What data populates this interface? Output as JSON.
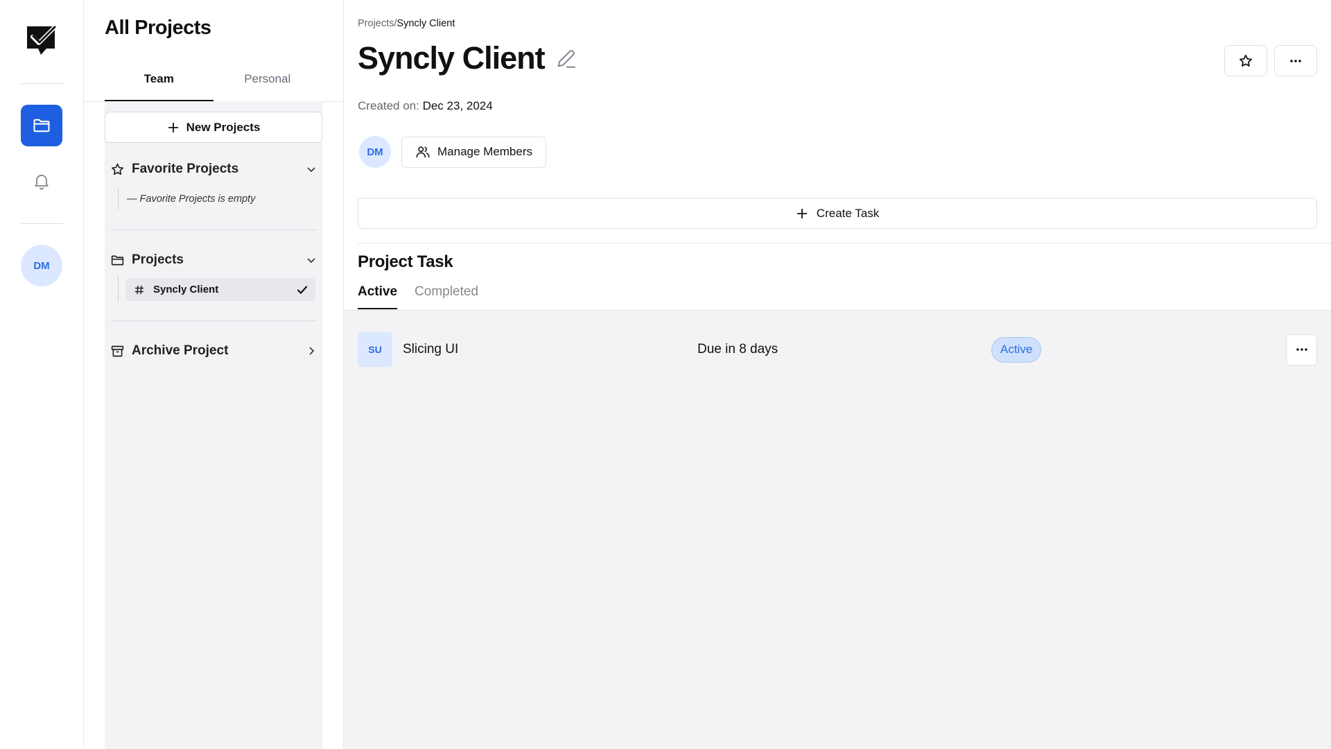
{
  "rail": {
    "avatar_initials": "DM",
    "icons": [
      "logo-check-icon",
      "folder-icon",
      "bell-icon"
    ]
  },
  "sidebar": {
    "title": "All Projects",
    "tabs": [
      {
        "label": "Team",
        "active": true
      },
      {
        "label": "Personal",
        "active": false
      }
    ],
    "new_button": "New Projects",
    "favorites": {
      "label": "Favorite Projects",
      "empty_text": "— Favorite Projects is empty"
    },
    "projects": {
      "label": "Projects",
      "items": [
        {
          "name": "Syncly Client",
          "selected": true
        }
      ]
    },
    "archive": {
      "label": "Archive Project"
    }
  },
  "main": {
    "breadcrumb": {
      "parent": "Projects",
      "sep": "/",
      "current": "Syncly Client"
    },
    "title": "Syncly Client",
    "created_label": "Created on:",
    "created_value": "Dec 23, 2024",
    "member_initials": "DM",
    "manage_members": "Manage Members",
    "create_task": "Create Task",
    "section_title": "Project Task",
    "task_tabs": [
      {
        "label": "Active",
        "active": true
      },
      {
        "label": "Completed",
        "active": false
      }
    ],
    "tasks": [
      {
        "initials": "SU",
        "name": "Slicing UI",
        "due": "Due in 8 days",
        "status": "Active"
      }
    ]
  },
  "colors": {
    "accent": "#1d5fe0",
    "avatar_bg": "#dbe8ff",
    "avatar_text": "#2f6cdf"
  }
}
